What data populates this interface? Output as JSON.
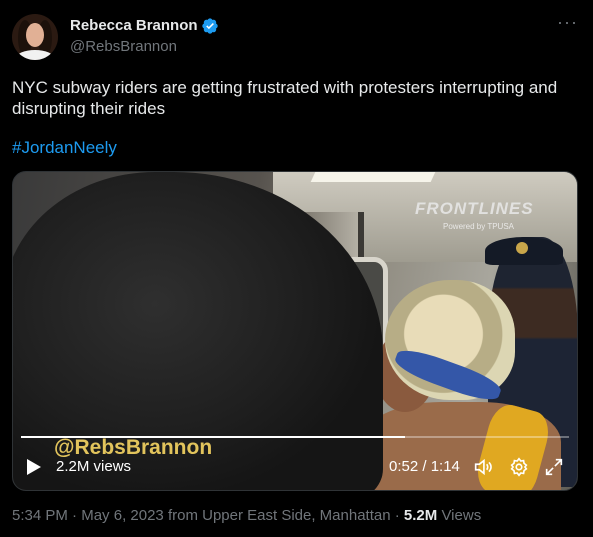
{
  "author": {
    "name": "Rebecca Brannon",
    "handle": "@RebsBrannon",
    "verified": true
  },
  "more_glyph": "···",
  "tweet": {
    "text": "NYC subway riders are getting frustrated with protesters interrupting and disrupting their rides",
    "hashtag": "#JordanNeely"
  },
  "video": {
    "watermark": "FRONTLINES",
    "watermark_sub": "Powered by TPUSA",
    "overlay_handle": "@RebsBrannon",
    "views": "2.2M views",
    "time": "0:52 / 1:14",
    "progress": 0.7
  },
  "meta": {
    "time": "5:34 PM",
    "date": "May 6, 2023",
    "location_prefix": "from",
    "location": "Upper East Side, Manhattan",
    "views_count": "5.2M",
    "views_label": "Views",
    "separator": "·"
  },
  "colors": {
    "background": "#000000",
    "text": "#e7e9ea",
    "muted": "#71767b",
    "link": "#1d9bf0",
    "verified": "#1d9bf0"
  }
}
